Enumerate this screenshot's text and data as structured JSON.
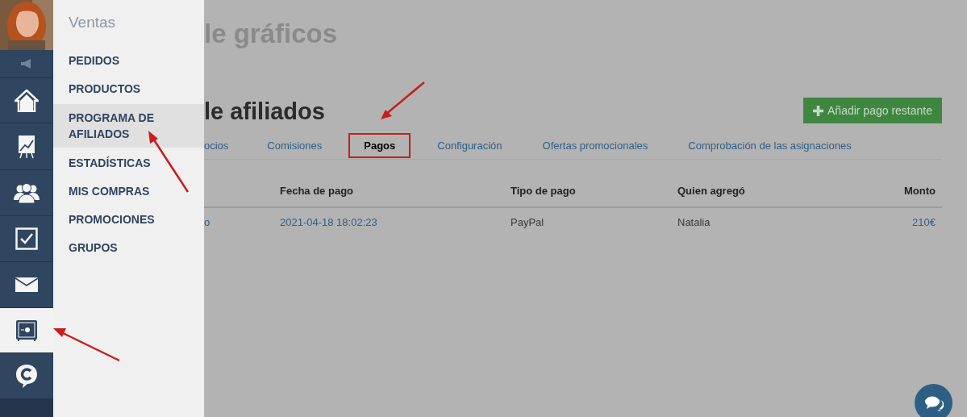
{
  "sidebar": {
    "items": [
      {
        "kind": "megaphone",
        "selected": false
      },
      {
        "kind": "home",
        "selected": false
      },
      {
        "kind": "chart",
        "selected": false
      },
      {
        "kind": "users",
        "selected": false
      },
      {
        "kind": "check",
        "selected": false
      },
      {
        "kind": "mail",
        "selected": false
      },
      {
        "kind": "safe",
        "selected": true
      },
      {
        "kind": "logo",
        "selected": false
      }
    ]
  },
  "flyout": {
    "title": "Ventas",
    "items": [
      {
        "label": "PEDIDOS",
        "selected": false
      },
      {
        "label": "PRODUCTOS",
        "selected": false
      },
      {
        "label": "PROGRAMA DE AFILIADOS",
        "selected": true
      },
      {
        "label": "ESTADÍSTICAS",
        "selected": false
      },
      {
        "label": "MIS COMPRAS",
        "selected": false
      },
      {
        "label": "PROMOCIONES",
        "selected": false
      },
      {
        "label": "GRUPOS",
        "selected": false
      }
    ]
  },
  "page": {
    "title": "le gráficos",
    "section_title": "le afiliados",
    "add_button": "Añadir pago restante",
    "tabs": [
      {
        "label": "ocios",
        "selected": false
      },
      {
        "label": "Comisiones",
        "selected": false
      },
      {
        "label": "Pagos",
        "selected": true
      },
      {
        "label": "Configuración",
        "selected": false
      },
      {
        "label": "Ofertas promocionales",
        "selected": false
      },
      {
        "label": "Comprobación de las asignaciones",
        "selected": false
      }
    ],
    "table": {
      "columns": [
        "",
        "Fecha de pago",
        "Tipo de pago",
        "Quien agregó",
        "Monto"
      ],
      "rows": [
        {
          "cells": [
            "o",
            "2021-04-18 18:02:23",
            "PayPal",
            "Natalia",
            "210€"
          ]
        }
      ]
    }
  }
}
